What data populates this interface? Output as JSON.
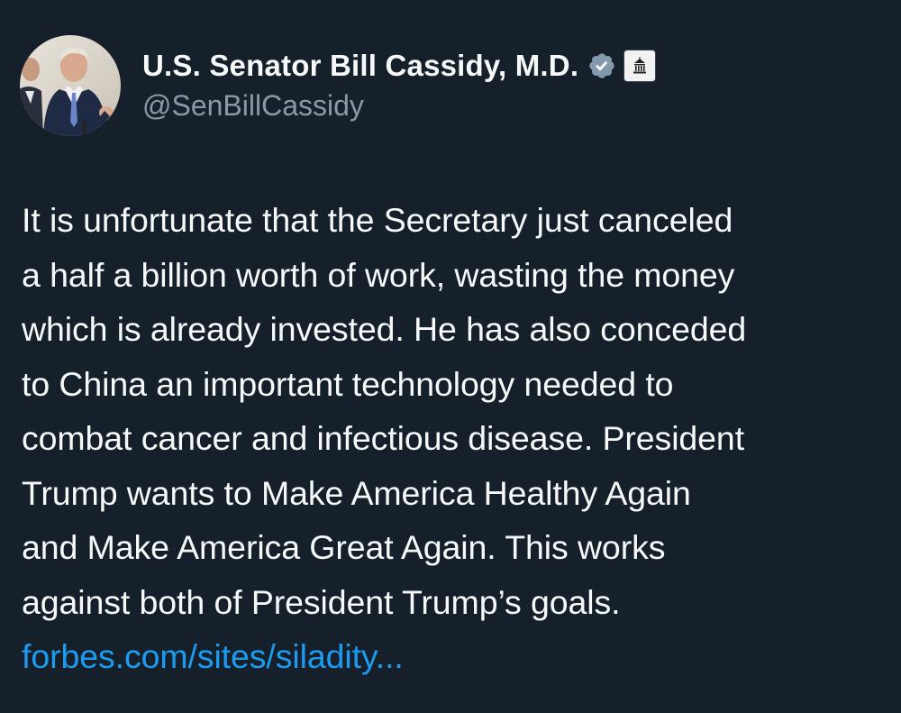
{
  "author": {
    "display_name": "U.S. Senator Bill Cassidy, M.D.",
    "handle": "@SenBillCassidy",
    "verified_icon": "verified-badge-icon",
    "affiliation_icon": "government-building-icon"
  },
  "tweet": {
    "lines": [
      "It is unfortunate that the Secretary just canceled",
      "a half a billion worth of work, wasting the money",
      "which is already invested. He has also conceded",
      "to China an important technology needed to",
      "combat cancer and infectious disease. President",
      "Trump wants to Make America Healthy Again",
      "and Make America Great Again. This works",
      "against both of President Trump’s goals."
    ],
    "link_text": "forbes.com/sites/siladity..."
  },
  "colors": {
    "background": "#15202b",
    "text": "#f7f9f9",
    "secondary_text": "#8b98a5",
    "link": "#1d9bf0",
    "verified_badge": "#829aab"
  }
}
